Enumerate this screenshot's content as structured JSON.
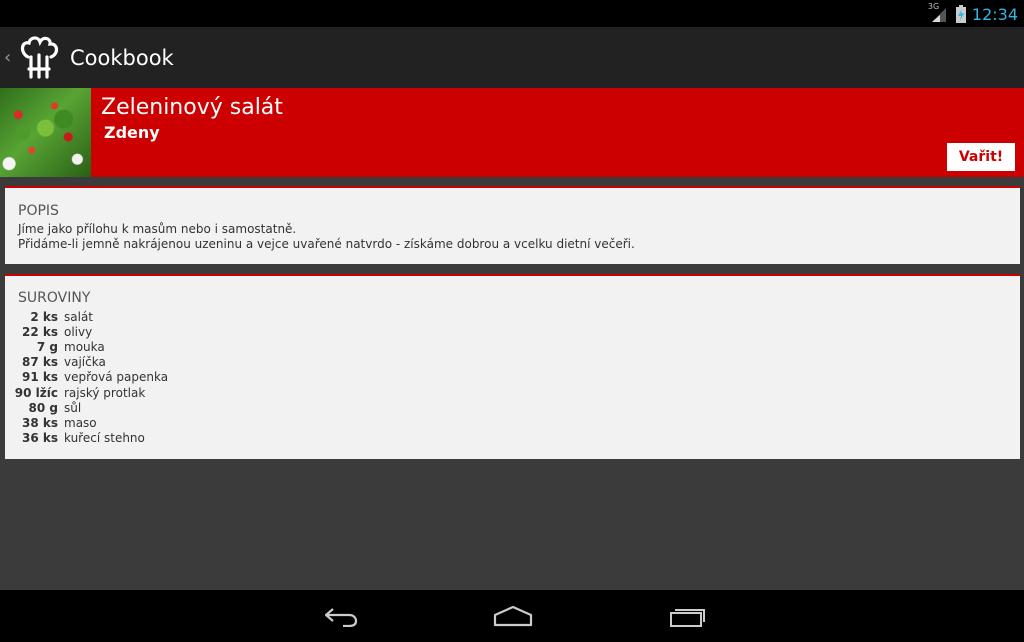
{
  "status_bar": {
    "network": "3G",
    "time": "12:34"
  },
  "action_bar": {
    "title": "Cookbook",
    "up_icon": "chevron-left-icon",
    "logo_icon": "chef-hat-icon"
  },
  "recipe": {
    "title": "Zeleninový salát",
    "author": "Zdeny",
    "cook_label": "Vařit!"
  },
  "description": {
    "heading": "POPIS",
    "lines": [
      "Jíme jako přílohu k masům nebo i samostatně.",
      "Přidáme-li jemně nakrájenou uzeninu a vejce uvařené natvrdo - získáme dobrou a vcelku dietní večeři."
    ]
  },
  "ingredients": {
    "heading": "SUROVINY",
    "items": [
      {
        "qty": "2 ks",
        "name": "salát"
      },
      {
        "qty": "22 ks",
        "name": "olivy"
      },
      {
        "qty": "7 g",
        "name": "mouka"
      },
      {
        "qty": "87 ks",
        "name": "vajíčka"
      },
      {
        "qty": "91 ks",
        "name": "vepřová papenka"
      },
      {
        "qty": "90 lžíc",
        "name": "rajský protlak"
      },
      {
        "qty": "80 g",
        "name": "sůl"
      },
      {
        "qty": "38 ks",
        "name": "maso"
      },
      {
        "qty": "36 ks",
        "name": "kuřecí stehno"
      }
    ]
  },
  "nav_bar": {
    "back_icon": "back-icon",
    "home_icon": "home-icon",
    "recent_icon": "recent-apps-icon"
  },
  "colors": {
    "accent": "#cc0000",
    "clock": "#33b5e5",
    "action_bar": "#222222",
    "card": "#f2f2f2"
  }
}
